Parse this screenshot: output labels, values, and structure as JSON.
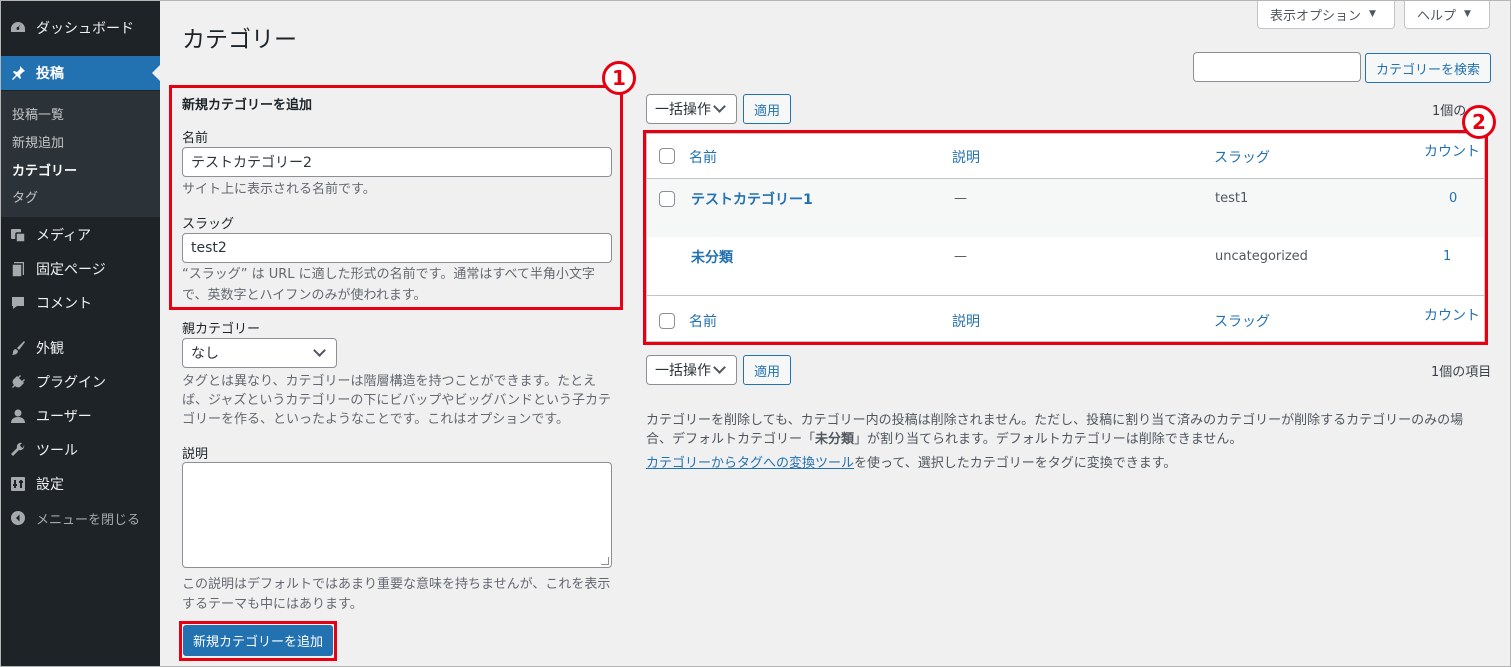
{
  "sidebar": {
    "items": [
      {
        "label": "ダッシュボード",
        "icon": "dashboard-icon"
      },
      {
        "label": "投稿",
        "icon": "pin-icon",
        "current": true
      },
      {
        "label": "メディア",
        "icon": "media-icon"
      },
      {
        "label": "固定ページ",
        "icon": "page-icon"
      },
      {
        "label": "コメント",
        "icon": "comment-icon"
      },
      {
        "label": "外観",
        "icon": "brush-icon"
      },
      {
        "label": "プラグイン",
        "icon": "plugin-icon"
      },
      {
        "label": "ユーザー",
        "icon": "user-icon"
      },
      {
        "label": "ツール",
        "icon": "wrench-icon"
      },
      {
        "label": "設定",
        "icon": "settings-icon"
      }
    ],
    "submenu": [
      "投稿一覧",
      "新規追加",
      "カテゴリー",
      "タグ"
    ],
    "collapse_label": "メニューを閉じる"
  },
  "header": {
    "title": "カテゴリー",
    "screen_options": "表示オプション",
    "help": "ヘルプ",
    "search_button": "カテゴリーを検索",
    "search_value": ""
  },
  "form": {
    "heading": "新規カテゴリーを追加",
    "name_label": "名前",
    "name_value": "テストカテゴリー2",
    "name_desc": "サイト上に表示される名前です。",
    "slug_label": "スラッグ",
    "slug_value": "test2",
    "slug_desc_1": "“スラッグ” は URL に適した形式の名前です。通常はすべて半角小文字",
    "slug_desc_2": "で、英数字とハイフンのみが使われます。",
    "parent_label": "親カテゴリー",
    "parent_value": "なし",
    "parent_desc_1": "タグとは異なり、カテゴリーは階層構造を持つことができます。たとえ",
    "parent_desc_2": "ば、ジャズというカテゴリーの下にビバップやビッグバンドという子カテ",
    "parent_desc_3": "ゴリーを作る、といったようなことです。これはオプションです。",
    "description_label": "説明",
    "description_desc_1": "この説明はデフォルトではあまり重要な意味を持ちませんが、これを表示",
    "description_desc_2": "するテーマも中にはあります。",
    "submit": "新規カテゴリーを追加"
  },
  "list": {
    "bulk_action": "一括操作",
    "apply": "適用",
    "item_count": "1個の項目",
    "item_count_top": "1個の",
    "columns": {
      "name": "名前",
      "description": "説明",
      "slug": "スラッグ",
      "count": "カウント"
    },
    "rows": [
      {
        "name": "テストカテゴリー1",
        "description": "—",
        "slug": "test1",
        "count": "0"
      },
      {
        "name": "未分類",
        "description": "—",
        "slug": "uncategorized",
        "count": "1"
      }
    ]
  },
  "notes": {
    "line1": "カテゴリーを削除しても、カテゴリー内の投稿は削除されません。ただし、投稿に割り当て済みのカテゴリーが削除するカテゴリーのみの場",
    "line2_pre": "合、デフォルトカテゴリー「",
    "line2_bold": "未分類",
    "line2_post": "」が割り当てられます。デフォルトカテゴリーは削除できません。",
    "link": "カテゴリーからタグへの変換ツール",
    "line3_post": "を使って、選択したカテゴリーをタグに変換できます。"
  },
  "annotations": {
    "badge1": "1",
    "badge2": "2",
    "color": "#e60012"
  }
}
